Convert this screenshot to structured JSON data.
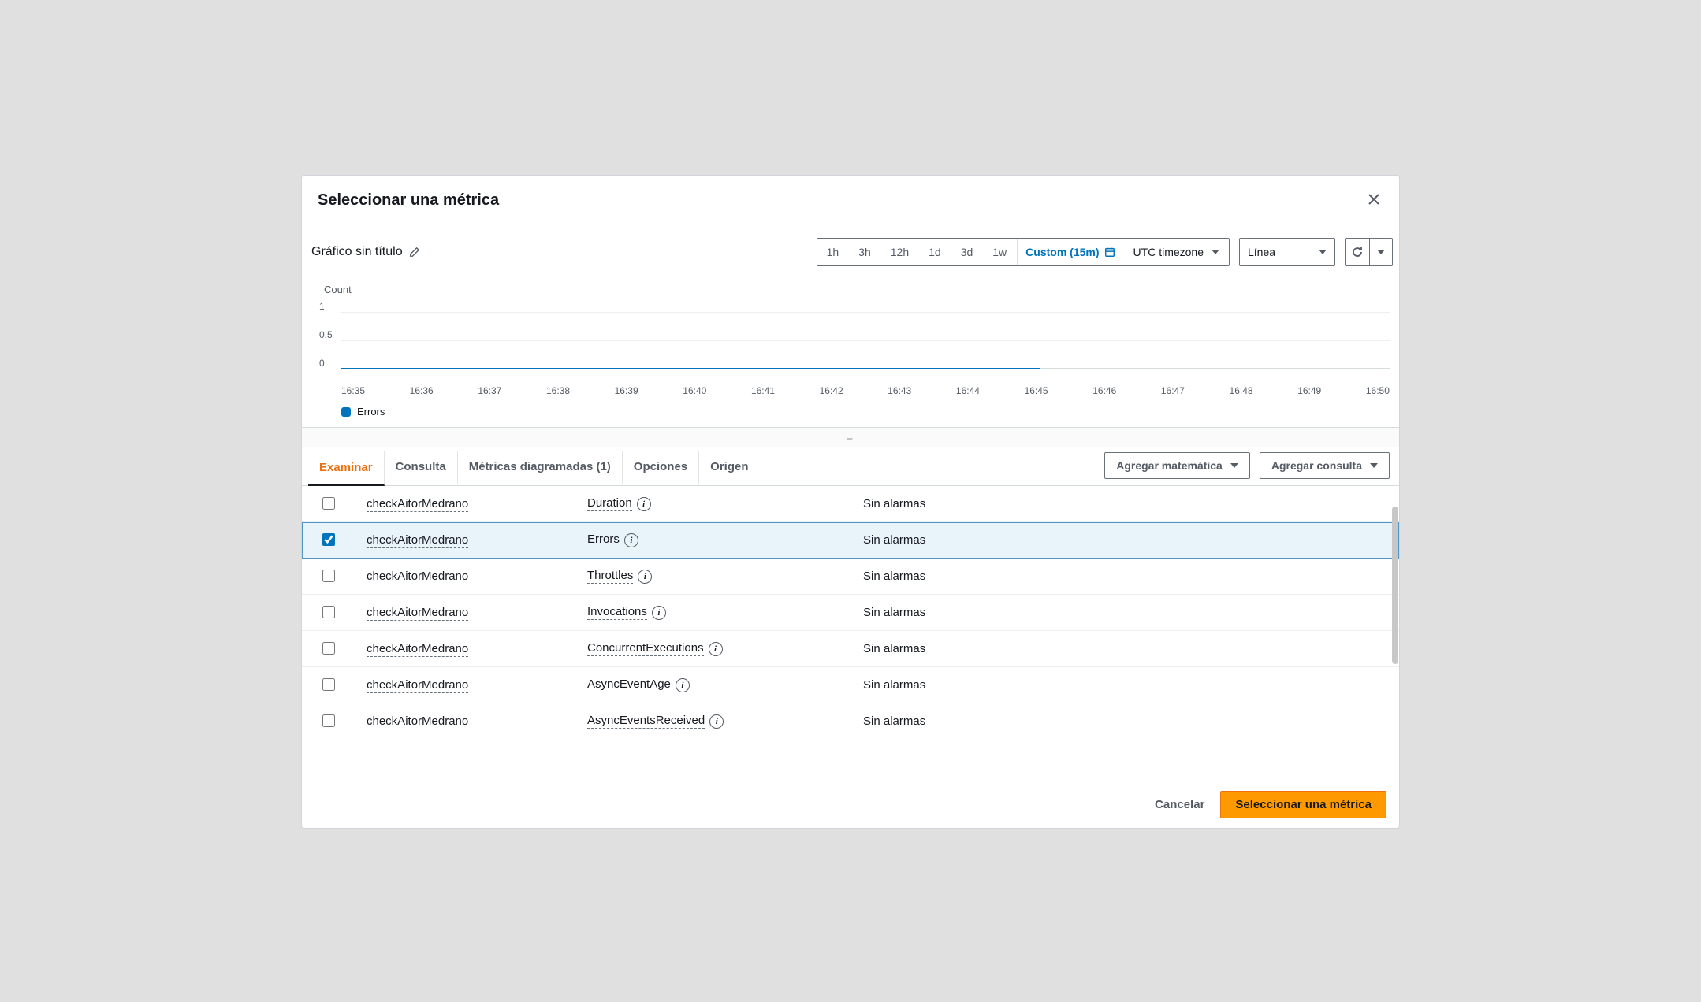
{
  "dialog_title": "Seleccionar una métrica",
  "chart_title": "Gráfico sin título",
  "range": {
    "h1": "1h",
    "h3": "3h",
    "h12": "12h",
    "d1": "1d",
    "d3": "3d",
    "w1": "1w",
    "custom": "Custom (15m)",
    "tz": "UTC timezone"
  },
  "chart_type": "Línea",
  "chart_ylabel": "Count",
  "chart_data": {
    "type": "line",
    "title": "Count",
    "xlabel": "",
    "ylabel": "Count",
    "categories": [
      "16:35",
      "16:36",
      "16:37",
      "16:38",
      "16:39",
      "16:40",
      "16:41",
      "16:42",
      "16:43",
      "16:44",
      "16:45",
      "16:46",
      "16:47",
      "16:48",
      "16:49",
      "16:50"
    ],
    "series": [
      {
        "name": "Errors",
        "values": [
          0,
          0,
          0,
          0,
          0,
          0,
          0,
          0,
          0,
          0,
          0,
          null,
          null,
          null,
          null,
          null
        ]
      }
    ],
    "ylim": [
      0,
      1
    ],
    "yticks": [
      0,
      0.5,
      1
    ]
  },
  "legend_series": "Errors",
  "tabs": {
    "examinar": "Examinar",
    "consulta": "Consulta",
    "diagramadas": "Métricas diagramadas (1)",
    "opciones": "Opciones",
    "origen": "Origen"
  },
  "btn_add_math": "Agregar matemática",
  "btn_add_query": "Agregar consulta",
  "rows": [
    {
      "fn": "checkAitorMedrano",
      "metric": "Duration",
      "alarm": "Sin alarmas",
      "sel": false
    },
    {
      "fn": "checkAitorMedrano",
      "metric": "Errors",
      "alarm": "Sin alarmas",
      "sel": true
    },
    {
      "fn": "checkAitorMedrano",
      "metric": "Throttles",
      "alarm": "Sin alarmas",
      "sel": false
    },
    {
      "fn": "checkAitorMedrano",
      "metric": "Invocations",
      "alarm": "Sin alarmas",
      "sel": false
    },
    {
      "fn": "checkAitorMedrano",
      "metric": "ConcurrentExecutions",
      "alarm": "Sin alarmas",
      "sel": false
    },
    {
      "fn": "checkAitorMedrano",
      "metric": "AsyncEventAge",
      "alarm": "Sin alarmas",
      "sel": false
    },
    {
      "fn": "checkAitorMedrano",
      "metric": "AsyncEventsReceived",
      "alarm": "Sin alarmas",
      "sel": false
    }
  ],
  "footer": {
    "cancel": "Cancelar",
    "select": "Seleccionar una métrica"
  }
}
